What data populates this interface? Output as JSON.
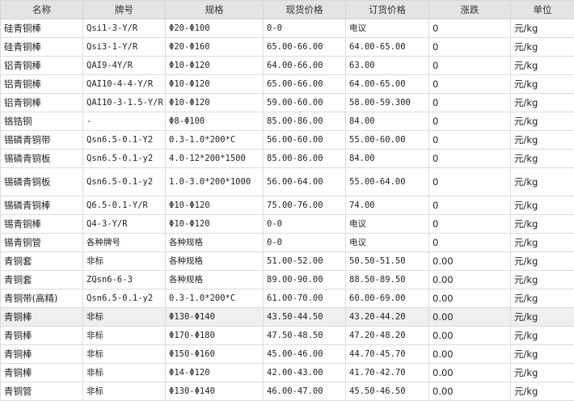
{
  "table": {
    "columns": [
      "名称",
      "牌号",
      "规格",
      "现货价格",
      "订货价格",
      "涨跌",
      "单位"
    ],
    "rows": [
      [
        "硅青铜棒",
        "Qsi1-3-Y/R",
        "Φ20-Φ100",
        "0-0",
        "电议",
        "0",
        "元/kg"
      ],
      [
        "硅青铜棒",
        "Qsi3-1-Y/R",
        "Φ20-Φ160",
        "65.00-66.00",
        "64.00-65.00",
        "0",
        "元/kg"
      ],
      [
        "铝青铜棒",
        "QAI9-4Y/R",
        "Φ10-Φ120",
        "64.00-66.00",
        "63.00",
        "0",
        "元/kg"
      ],
      [
        "铝青铜棒",
        "QAI10-4-4-Y/R",
        "Φ10-Φ120",
        "65.00-66.00",
        "64.00-65.00",
        "0",
        "元/kg"
      ],
      [
        "铝青铜棒",
        "QAI10-3-1.5-Y/R",
        "Φ10-Φ120",
        "59.00-60.00",
        "58.00-59.300",
        "0",
        "元/kg"
      ],
      [
        "铬锆铜",
        "-",
        "Φ8-Φ100",
        "85.00-86.00",
        "84.00",
        "0",
        "元/kg"
      ],
      [
        "锡磷青铜带",
        "Qsn6.5-0.1-Y2",
        "0.3-1.0*200*C",
        "56.00-60.00",
        "55.00-60.00",
        "0",
        "元/kg"
      ],
      [
        "锡磷青铜板",
        "Qsn6.5-0.1-y2",
        "4.0-12*200*1500",
        "85.00-86.00",
        "84.00",
        "0",
        "元/kg"
      ],
      [
        "锡磷青铜板",
        "Qsn6.5-0.1-y2",
        "1.0-3.0*200*1000",
        "56.00-64.00",
        "55.00-64.00",
        "0",
        "元/kg"
      ],
      [
        "锡磷青铜棒",
        "Q6.5-0.1-Y/R",
        "Φ10-Φ120",
        "75.00-76.00",
        "74.00",
        "0",
        "元/kg"
      ],
      [
        "锡青铜棒",
        "Q4-3-Y/R",
        "Φ10-Φ120",
        "0-0",
        "电议",
        "0",
        "元/kg"
      ],
      [
        "锡青铜管",
        "各种牌号",
        "各种规格",
        "0-0",
        "电议",
        "0",
        "元/kg"
      ],
      [
        "青铜套",
        "非标",
        "各种规格",
        "51.00-52.00",
        "50.50-51.50",
        "0.00",
        "元/kg"
      ],
      [
        "青铜套",
        "ZQsn6-6-3",
        "各种规格",
        "89.00-90.00",
        "88.50-89.50",
        "0.00",
        "元/kg"
      ],
      [
        "青铜带(高精)",
        "Qsn6.5-0.1-y2",
        "0.3-1.0*200*C",
        "61.00-70.00",
        "60.00-69.00",
        "0.00",
        "元/kg"
      ],
      [
        "青铜棒",
        "非标",
        "Φ130-Φ140",
        "43.50-44.50",
        "43.20-44.20",
        "0.00",
        "元/kg"
      ],
      [
        "青铜棒",
        "非标",
        "Φ170-Φ180",
        "47.50-48.50",
        "47.20-48.20",
        "0.00",
        "元/kg"
      ],
      [
        "青铜棒",
        "非标",
        "Φ150-Φ160",
        "45.00-46.00",
        "44.70-45.70",
        "0.00",
        "元/kg"
      ],
      [
        "青铜棒",
        "非标",
        "Φ14-Φ120",
        "42.00-43.00",
        "41.70-42.70",
        "0.00",
        "元/kg"
      ],
      [
        "青铜管",
        "非标",
        "Φ130-Φ140",
        "46.00-47.00",
        "45.50-46.50",
        "0.00",
        "元/kg"
      ]
    ]
  }
}
